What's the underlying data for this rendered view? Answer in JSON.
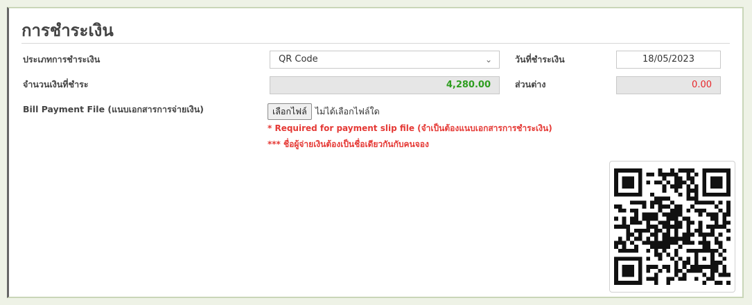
{
  "section": {
    "title": "การชำระเงิน"
  },
  "payment_type": {
    "label": "ประเภทการชำระเงิน",
    "value": "QR Code"
  },
  "payment_date": {
    "label": "วันที่ชำระเงิน",
    "value": "18/05/2023"
  },
  "amount": {
    "label": "จำนวนเงินที่ชำระ",
    "value": "4,280.00"
  },
  "difference": {
    "label": "ส่วนต่าง",
    "value": "0.00"
  },
  "bill_file": {
    "label": "Bill Payment File (แนบเอกสารการจ่ายเงิน)",
    "button_label": "เลือกไฟล์",
    "status": "ไม่ได้เลือกไฟล์ใด",
    "note_required": "* Required for payment slip file (จำเป็นต้องแนบเอกสารการชำระเงิน)",
    "note_name": "*** ชื่อผู้จ่ายเงินต้องเป็นชื่อเดียวกันกับคนจอง"
  },
  "qr": {
    "icon": "qr-code-image"
  },
  "colors": {
    "amount_text": "#2e9d1f",
    "difference_text": "#e8262a",
    "note_text": "#e53935"
  }
}
